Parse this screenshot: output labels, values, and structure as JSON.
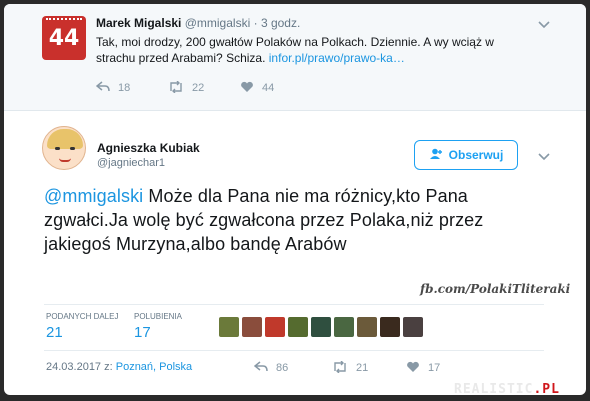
{
  "parent_tweet": {
    "name": "Marek Migalski",
    "handle": "@mmigalski",
    "separator": "·",
    "time": "3 godz.",
    "avatar_text": "44",
    "text": "Tak, moi drodzy, 200 gwałtów Polaków na Polkach. Dziennie. A wy wciąż w strachu przed Arabami? Schiza.",
    "link": "infor.pl/prawo/prawo-ka…",
    "replies": "18",
    "retweets": "22",
    "likes": "44"
  },
  "main_tweet": {
    "name": "Agnieszka Kubiak",
    "handle": "@jagniechar1",
    "follow_label": "Obserwuj",
    "mention": "@mmigalski",
    "text": " Może dla Pana nie ma różnicy,kto Pana zgwałci.Ja wolę być zgwałcona przez Polaka,niż przez jakiegoś Murzyna,albo bandę Arabów",
    "retweets_label": "PODANYCH DALEJ",
    "retweets_count": "21",
    "likes_label": "POLUBIENIA",
    "likes_count": "17",
    "date": "24.03.2017 z:",
    "location": "Poznań, Polska",
    "replies": "86",
    "retweets": "21",
    "likes": "17"
  },
  "watermark": "fb.com/PolakiTliteraki",
  "brand": {
    "prefix": "REALISTIC",
    "suffix": ".PL"
  },
  "likers": [
    "#6b7a3a",
    "#8a4d3c",
    "#c0392b",
    "#556b2f",
    "#2f4f3f",
    "#4a6741",
    "#6b5a3a",
    "#3a2a1e",
    "#4a4040"
  ],
  "icons": [
    "chevron-down-icon",
    "reply-icon",
    "retweet-icon",
    "heart-icon",
    "follow-user-icon"
  ],
  "colors": {
    "accent": "#1da1f2",
    "link": "#1b95e0",
    "muted": "#657786"
  }
}
